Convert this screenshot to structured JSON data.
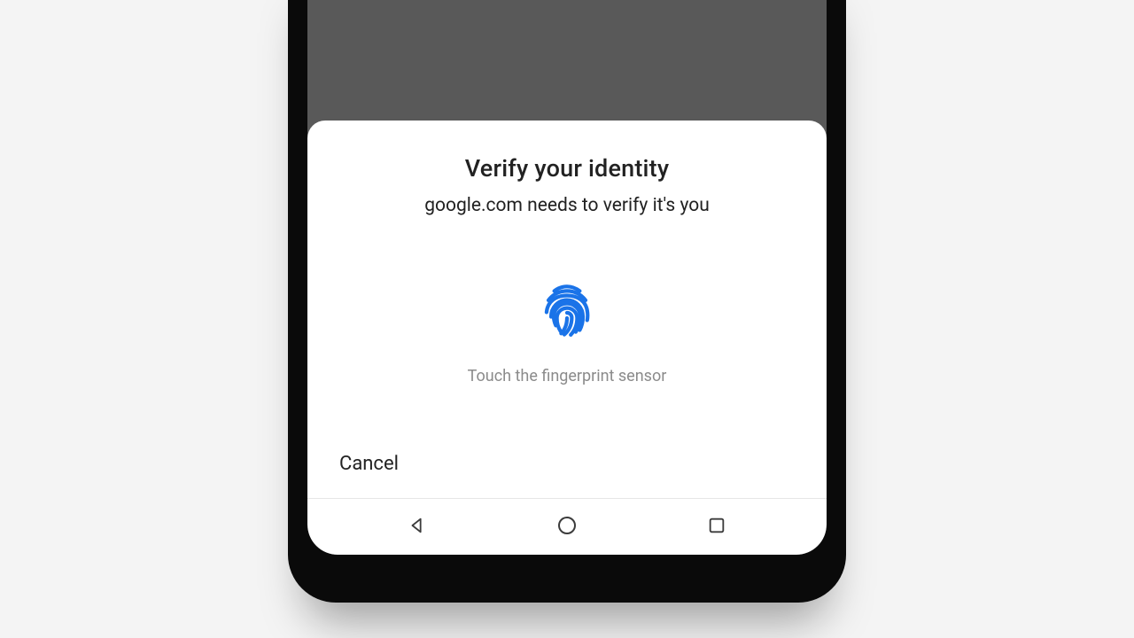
{
  "dialog": {
    "title": "Verify your identity",
    "subtitle": "google.com needs to verify it's you",
    "hint": "Touch the fingerprint sensor",
    "cancel_label": "Cancel"
  },
  "icons": {
    "fingerprint": "fingerprint-icon",
    "nav_back": "back-triangle-icon",
    "nav_home": "home-circle-icon",
    "nav_recent": "recent-square-icon"
  },
  "colors": {
    "accent": "#1a73e8"
  }
}
